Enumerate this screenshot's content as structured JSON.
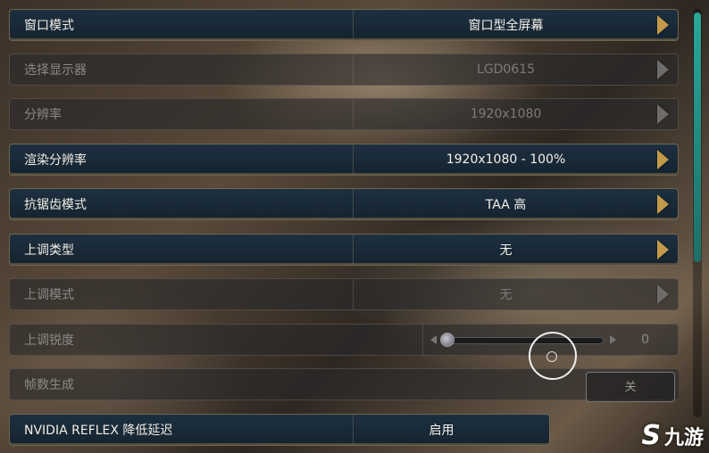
{
  "settings": [
    {
      "label": "窗口模式",
      "value": "窗口型全屏幕",
      "state": "enabled"
    },
    {
      "label": "选择显示器",
      "value": "LGD0615",
      "state": "disabled"
    },
    {
      "label": "分辨率",
      "value": "1920x1080",
      "state": "disabled"
    },
    {
      "label": "渲染分辨率",
      "value": "1920x1080 - 100%",
      "state": "enabled"
    },
    {
      "label": "抗锯齿模式",
      "value": "TAA 高",
      "state": "enabled"
    },
    {
      "label": "上调类型",
      "value": "无",
      "state": "enabled"
    },
    {
      "label": "上调模式",
      "value": "无",
      "state": "disabled"
    }
  ],
  "sharpness": {
    "label": "上调锐度",
    "value": "0",
    "level": 0
  },
  "frame_gen": {
    "label": "帧数生成",
    "toggle_label": "关"
  },
  "reflex": {
    "label": "NVIDIA REFLEX 降低延迟",
    "value": "启用"
  },
  "watermark": {
    "logo_text": "S",
    "text": "九游"
  },
  "colors": {
    "accent_gold": "#c39a4a",
    "scrollbar_teal": "#2aa79a",
    "row_blue": "#1d3040"
  }
}
